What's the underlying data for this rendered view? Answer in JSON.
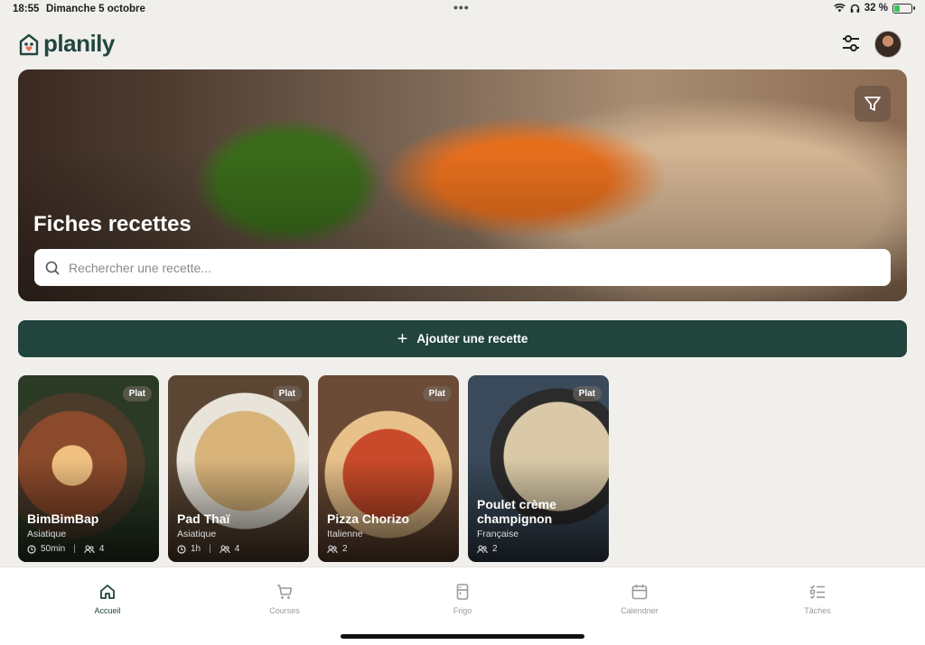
{
  "status_bar": {
    "time": "18:55",
    "date": "Dimanche 5 octobre",
    "dots": "•••",
    "battery": "32 %",
    "battery_level": 0.32
  },
  "header": {
    "logo_text": "planily",
    "icons": {
      "filters": "sliders-icon",
      "avatar": "user-avatar"
    }
  },
  "hero": {
    "title": "Fiches recettes",
    "filter_icon": "funnel-icon",
    "search_placeholder": "Rechercher une recette..."
  },
  "add_recipe": {
    "label": "Ajouter une recette",
    "icon": "plus-icon"
  },
  "recipes": [
    {
      "name": "BimBimBap",
      "cuisine": "Asiatique",
      "badge": "Plat",
      "time": "50min",
      "servings": "4"
    },
    {
      "name": "Pad Thaï",
      "cuisine": "Asiatique",
      "badge": "Plat",
      "time": "1h",
      "servings": "4"
    },
    {
      "name": "Pizza Chorizo",
      "cuisine": "Italienne",
      "badge": "Plat",
      "servings": "2"
    },
    {
      "name": "Poulet crème champignon",
      "cuisine": "Française",
      "badge": "Plat",
      "servings": "2"
    }
  ],
  "tabs": [
    {
      "label": "Accueil",
      "icon": "home-icon",
      "active": true
    },
    {
      "label": "Courses",
      "icon": "cart-icon",
      "active": false
    },
    {
      "label": "Frigo",
      "icon": "fridge-icon",
      "active": false
    },
    {
      "label": "Calendrier",
      "icon": "calendar-icon",
      "active": false
    },
    {
      "label": "Tâches",
      "icon": "checklist-icon",
      "active": false
    }
  ],
  "colors": {
    "accent": "#21443d",
    "background": "#f1efec"
  }
}
